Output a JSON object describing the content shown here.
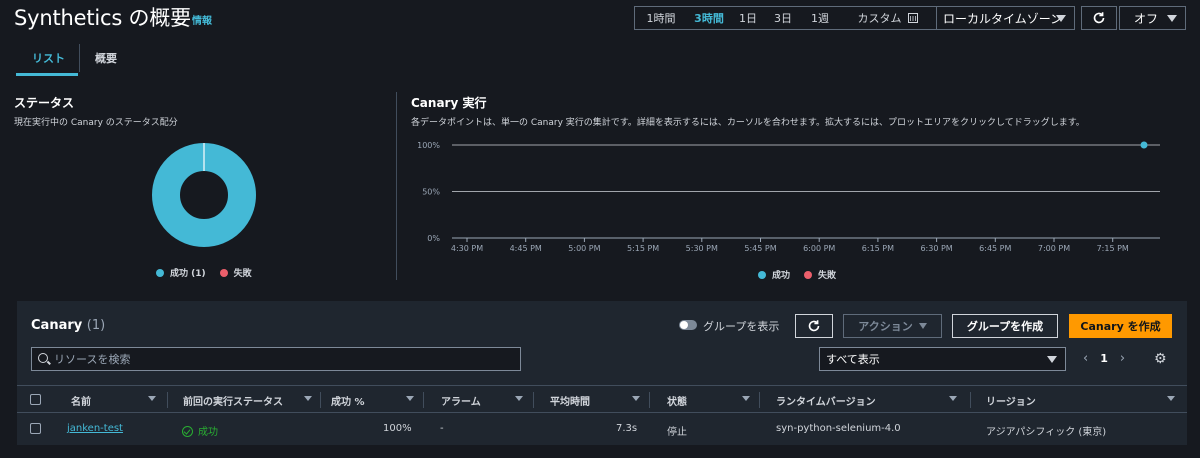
{
  "header": {
    "title": "Synthetics の概要",
    "info": "情報",
    "time_ranges": [
      "1時間",
      "3時間",
      "1日",
      "3日",
      "1週",
      "カスタム"
    ],
    "active_range": "3時間",
    "timezone": "ローカルタイムゾーン",
    "auto_refresh": "オフ"
  },
  "tabs": [
    "リスト",
    "概要"
  ],
  "status": {
    "title": "ステータス",
    "description": "現在実行中の Canary のステータス配分",
    "legend": [
      {
        "label": "成功 (1)",
        "color": "#44b9d6"
      },
      {
        "label": "失敗",
        "color": "#eb5f6b"
      }
    ],
    "chart_data": {
      "type": "pie",
      "categories": [
        "成功",
        "失敗"
      ],
      "values": [
        1,
        0
      ]
    }
  },
  "runs": {
    "title": "Canary 実行",
    "description": "各データポイントは、単一の Canary 実行の集計です。詳細を表示するには、カーソルを合わせます。拡大するには、プロットエリアをクリックしてドラッグします。",
    "legend": [
      {
        "label": "成功",
        "color": "#44b9d6"
      },
      {
        "label": "失敗",
        "color": "#eb5f6b"
      }
    ],
    "chart_data": {
      "type": "scatter",
      "x_ticks": [
        "4:30 PM",
        "4:45 PM",
        "5:00 PM",
        "5:15 PM",
        "5:30 PM",
        "5:45 PM",
        "6:00 PM",
        "6:15 PM",
        "6:30 PM",
        "6:45 PM",
        "7:00 PM",
        "7:15 PM"
      ],
      "y_ticks": [
        "0%",
        "50%",
        "100%"
      ],
      "ylim": [
        0,
        100
      ],
      "series": [
        {
          "name": "成功",
          "points": [
            {
              "x": "7:23 PM",
              "y": 100
            }
          ]
        }
      ]
    }
  },
  "canary": {
    "title": "Canary",
    "count": "(1)",
    "group_toggle": "グループを表示",
    "action_button": "アクション",
    "group_button": "グループを作成",
    "create_button": "Canary を作成",
    "search_placeholder": "リソースを検索",
    "filter": "すべて表示",
    "page": "1",
    "columns": [
      "名前",
      "前回の実行ステータス",
      "成功 %",
      "アラーム",
      "平均時間",
      "状態",
      "ランタイムバージョン",
      "リージョン"
    ],
    "rows": [
      {
        "name": "janken-test",
        "status": "成功",
        "success": "100%",
        "alarm": "-",
        "avg": "7.3s",
        "state": "停止",
        "runtime": "syn-python-selenium-4.0",
        "region": "アジアパシフィック (東京)"
      }
    ]
  },
  "colors": {
    "accent": "#44b9d6",
    "primary_button": "#ff9900",
    "success": "#29ad32",
    "fail": "#eb5f6b"
  }
}
